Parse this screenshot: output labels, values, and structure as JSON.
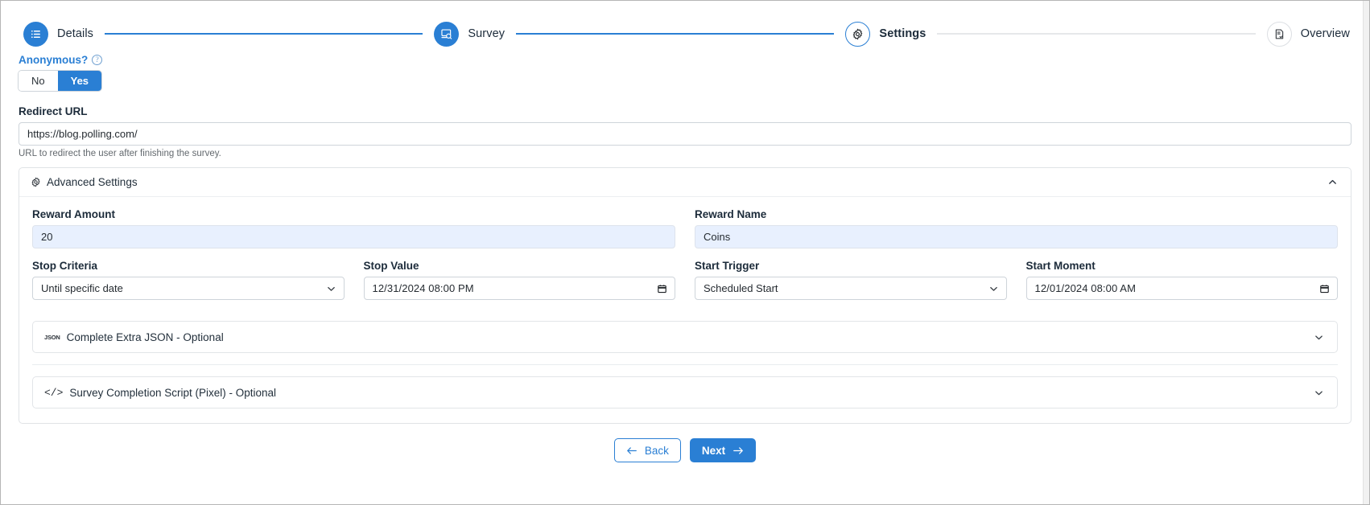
{
  "stepper": {
    "steps": [
      {
        "label": "Details",
        "icon": "list-icon",
        "state": "done"
      },
      {
        "label": "Survey",
        "icon": "survey-icon",
        "state": "done"
      },
      {
        "label": "Settings",
        "icon": "gear-icon",
        "state": "current"
      },
      {
        "label": "Overview",
        "icon": "document-check-icon",
        "state": "todo"
      }
    ],
    "accent": "#2a7fd4",
    "inactive": "#e6e8ea"
  },
  "anonymous": {
    "label": "Anonymous?",
    "help_icon": "help-circle-icon",
    "options": [
      "No",
      "Yes"
    ],
    "selected": "Yes"
  },
  "redirect": {
    "label": "Redirect URL",
    "value": "https://blog.polling.com/",
    "placeholder": "https://",
    "hint": "URL to redirect the user after finishing the survey."
  },
  "advanced": {
    "title": "Advanced Settings",
    "icon": "gear-icon",
    "caret": "collapse-caret-up",
    "reward_amount": {
      "label": "Reward Amount",
      "value": "20",
      "placeholder": "Reward Amount"
    },
    "reward_name": {
      "label": "Reward Name",
      "value": "Coins",
      "placeholder": "Reward Name"
    },
    "stop_criteria": {
      "label": "Stop Criteria",
      "value": "Until specific date",
      "options": [
        "Until specific date"
      ]
    },
    "stop_value": {
      "label": "Stop Value",
      "value": "12/31/2024 08:00 PM"
    },
    "start_trigger": {
      "label": "Start Trigger",
      "value": "Scheduled Start",
      "options": [
        "Scheduled Start"
      ]
    },
    "start_moment": {
      "label": "Start Moment",
      "value": "12/01/2024 08:00 AM"
    },
    "extra_json": {
      "label": "Complete Extra JSON - Optional",
      "icon": "json-icon",
      "caret": "expand-caret-down"
    },
    "pixel_script": {
      "label": "Survey Completion Script (Pixel) - Optional",
      "icon": "code-icon",
      "caret": "expand-caret-down"
    }
  },
  "footer": {
    "back": {
      "label": "Back",
      "icon": "arrow-left-icon"
    },
    "next": {
      "label": "Next",
      "icon": "arrow-right-icon"
    }
  }
}
